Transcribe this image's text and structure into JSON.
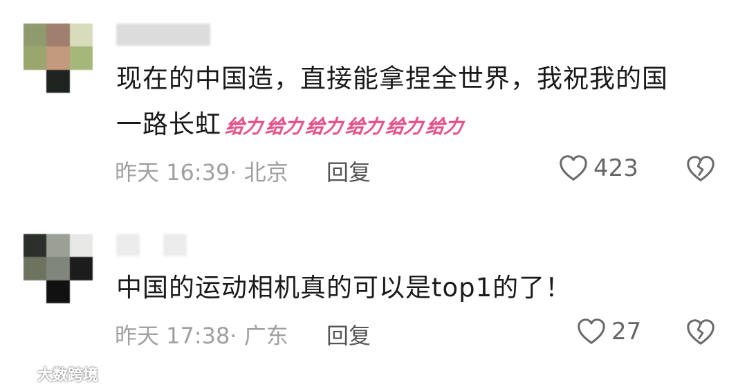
{
  "comments": [
    {
      "text_line1": "现在的中国造，直接能拿捏全世界，我祝我的国",
      "text_line2": "一路长虹",
      "emojis": [
        "给力",
        "给力",
        "给力",
        "给力",
        "给力",
        "给力"
      ],
      "meta": "昨天 16:39· 北京",
      "reply_label": "回复",
      "like_count": "423",
      "avatar_colors": [
        "#8f9b6f",
        "#a07f6e",
        "#d8dcbb",
        "#9aa66e",
        "#c49a7e",
        "#a6b77a",
        "#ffffff",
        "#1e2320",
        "#ffffff"
      ]
    },
    {
      "text_line1": "中国的运动相机真的可以是top1的了！",
      "meta": "昨天 17:38· 广东",
      "reply_label": "回复",
      "like_count": "27",
      "avatar_colors": [
        "#2d2f2c",
        "#9c9f96",
        "#e8e8e6",
        "#6e735f",
        "#81867a",
        "#1c1c1c",
        "#ffffff",
        "#111111",
        "#ffffff"
      ]
    }
  ],
  "watermark": "大数跨境",
  "icons": {
    "like": "heart-outline-icon",
    "dislike": "broken-heart-icon",
    "watermark_logo": "chain-logo-icon"
  },
  "colors": {
    "emoji_pink": "#e5508a",
    "meta_gray": "#a0a0a0",
    "text": "#1a1a1a"
  }
}
